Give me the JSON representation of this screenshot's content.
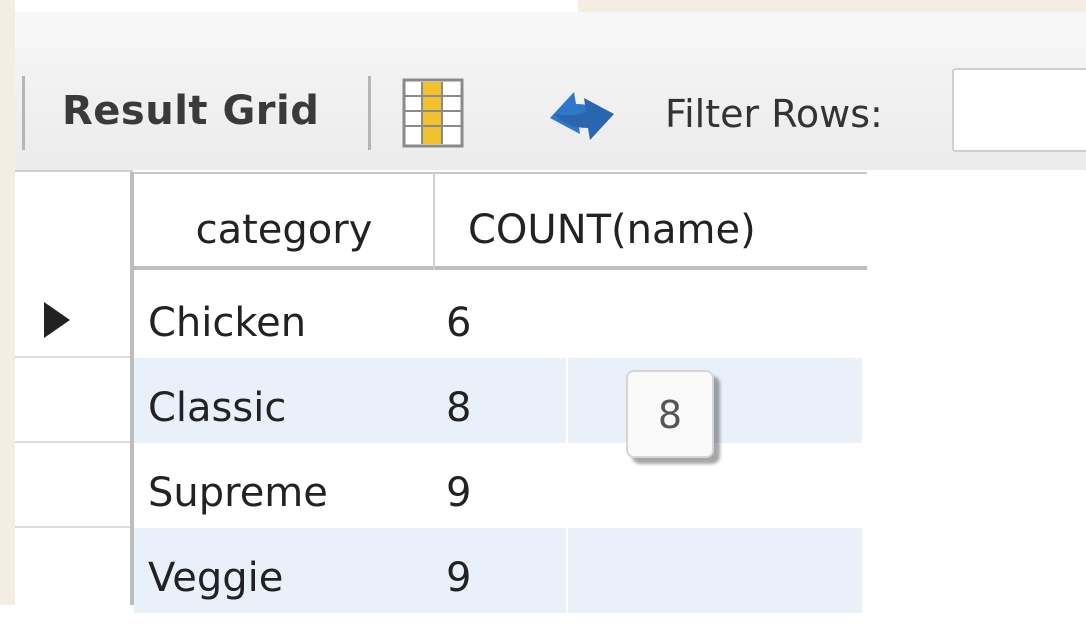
{
  "toolbar": {
    "result_grid_label": "Result Grid",
    "filter_label": "Filter Rows:",
    "filter_value": "",
    "icons": [
      "grid-toggle-icon",
      "refresh-icon"
    ]
  },
  "grid": {
    "columns": [
      "category",
      "COUNT(name)"
    ],
    "rows": [
      {
        "category": "Chicken",
        "count": "6"
      },
      {
        "category": "Classic",
        "count": "8"
      },
      {
        "category": "Supreme",
        "count": "9"
      },
      {
        "category": "Veggie",
        "count": "9"
      }
    ],
    "selected_row_index": 0
  },
  "tooltip": {
    "text": "8"
  },
  "colors": {
    "row_alt": "#eaf0fa",
    "beige": "#f3eee1",
    "grid_icon": "#f2c12e",
    "refresh_icon": "#2f77c8"
  }
}
